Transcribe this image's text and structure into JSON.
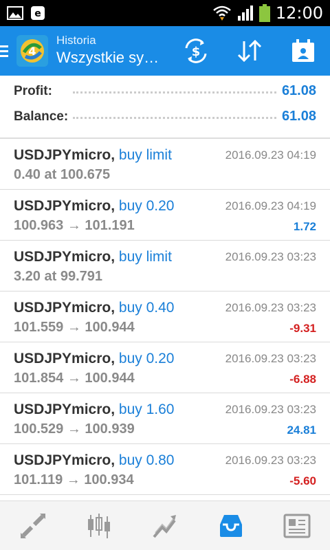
{
  "status": {
    "time": "12:00"
  },
  "appbar": {
    "subtitle": "Historia",
    "title": "Wszystkie sy…"
  },
  "summary": [
    {
      "label": "Profit:",
      "value": "61.08"
    },
    {
      "label": "Balance:",
      "value": "61.08"
    }
  ],
  "trades": [
    {
      "symbol": "USDJPYmicro,",
      "action": "buy limit",
      "detail": "0.40 at 100.675",
      "time": "2016.09.23 04:19",
      "profit": ""
    },
    {
      "symbol": "USDJPYmicro,",
      "action": "buy 0.20",
      "detail": "100.963 → 101.191",
      "time": "2016.09.23 04:19",
      "profit": "1.72"
    },
    {
      "symbol": "USDJPYmicro,",
      "action": "buy limit",
      "detail": "3.20 at 99.791",
      "time": "2016.09.23 03:23",
      "profit": ""
    },
    {
      "symbol": "USDJPYmicro,",
      "action": "buy 0.40",
      "detail": "101.559 → 100.944",
      "time": "2016.09.23 03:23",
      "profit": "-9.31"
    },
    {
      "symbol": "USDJPYmicro,",
      "action": "buy 0.20",
      "detail": "101.854 → 100.944",
      "time": "2016.09.23 03:23",
      "profit": "-6.88"
    },
    {
      "symbol": "USDJPYmicro,",
      "action": "buy 1.60",
      "detail": "100.529 → 100.939",
      "time": "2016.09.23 03:23",
      "profit": "24.81"
    },
    {
      "symbol": "USDJPYmicro,",
      "action": "buy 0.80",
      "detail": "101.119 → 100.934",
      "time": "2016.09.23 03:23",
      "profit": "-5.60"
    }
  ],
  "colors": {
    "accent": "#1a8ce6",
    "profit_positive": "#1a7fd8",
    "profit_negative": "#d42020",
    "active_tab": "#1a8ce6",
    "inactive_tab": "#9a9a9a"
  },
  "bottom_nav": [
    {
      "icon": "quotes-icon",
      "active": false
    },
    {
      "icon": "chart-icon",
      "active": false
    },
    {
      "icon": "trade-icon",
      "active": false
    },
    {
      "icon": "history-icon",
      "active": true
    },
    {
      "icon": "news-icon",
      "active": false
    }
  ]
}
